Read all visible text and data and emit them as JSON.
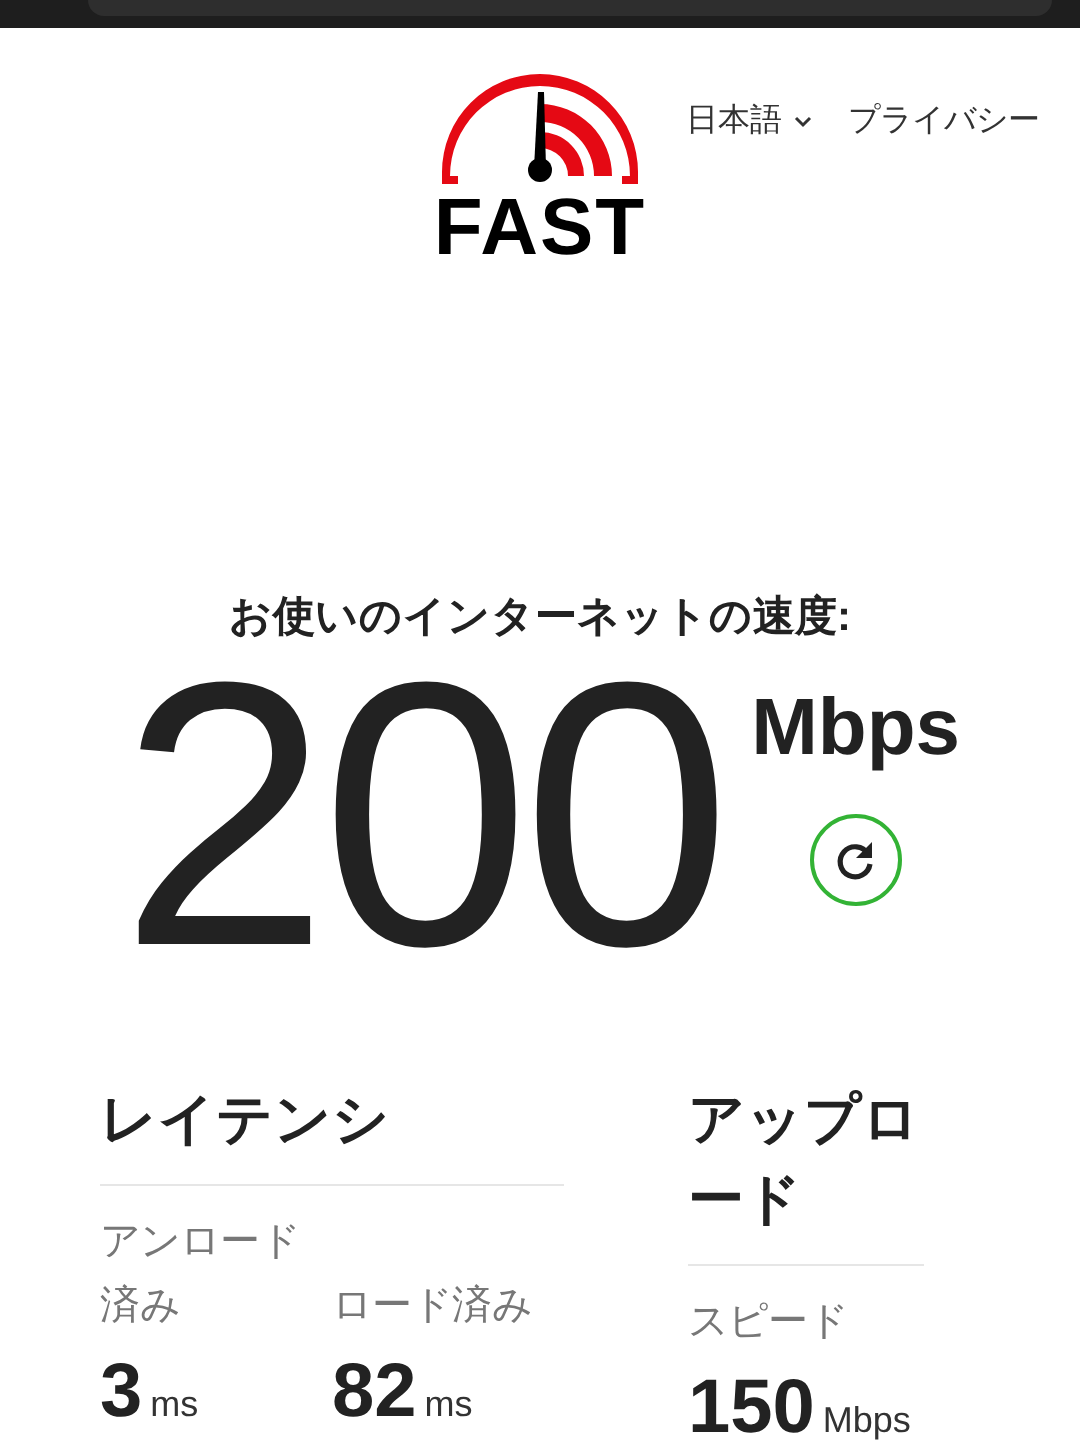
{
  "header": {
    "logo": "FAST",
    "language": "日本語",
    "privacy": "プライバシー"
  },
  "speed": {
    "heading": "お使いのインターネットの速度:",
    "value": "200",
    "unit": "Mbps"
  },
  "latency": {
    "title": "レイテンシ",
    "metrics": [
      {
        "label": "アンロード済み",
        "value": "3",
        "unit": "ms"
      },
      {
        "label": "ロード済み",
        "value": "82",
        "unit": "ms"
      }
    ]
  },
  "upload": {
    "title": "アップロード",
    "metrics": [
      {
        "label": "スピード",
        "value": "150",
        "unit": "Mbps"
      }
    ]
  }
}
